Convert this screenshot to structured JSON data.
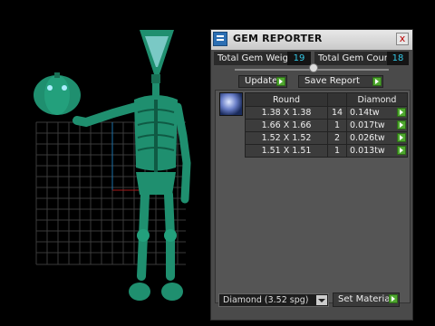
{
  "window": {
    "title": "GEM REPORTER",
    "close_glyph": "x"
  },
  "summary": {
    "weight_label": "Total Gem Weight",
    "weight_value": "19",
    "count_label": "Total Gem Count",
    "count_value": "18"
  },
  "slider": {
    "position": 0.5
  },
  "buttons": {
    "update": "Update",
    "save_report": "Save Report"
  },
  "table": {
    "headers": [
      "Round",
      "",
      "Diamond"
    ],
    "rows": [
      {
        "size": "1.38 X 1.38",
        "count": "14",
        "weight": "0.14tw"
      },
      {
        "size": "1.66 X 1.66",
        "count": "1",
        "weight": "0.017tw"
      },
      {
        "size": "1.52 X 1.52",
        "count": "2",
        "weight": "0.026tw"
      },
      {
        "size": "1.51 X 1.51",
        "count": "1",
        "weight": "0.013tw"
      }
    ]
  },
  "material": {
    "selected": "Diamond    (3.52 spg)",
    "set_label": "Set Material"
  },
  "colors": {
    "model": "#1f8f6f",
    "grid": "#3a3a3a",
    "accent_value": "#34c8e6",
    "go_button": "#4fa72f"
  }
}
